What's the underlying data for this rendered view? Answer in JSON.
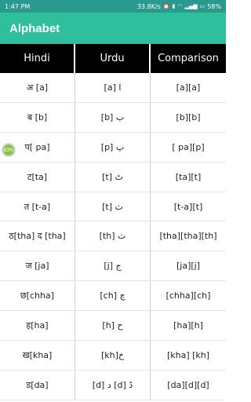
{
  "status_bar": {
    "time": "1:47 PM",
    "speed": "33.8K/s",
    "battery": "58%"
  },
  "app_bar": {
    "title": "Alphabet"
  },
  "table": {
    "headers": [
      "Hindi",
      "Urdu",
      "Comparison"
    ],
    "rows": [
      {
        "hindi": "अ [a]",
        "urdu": "[a] ا",
        "comparison": "[a][a]"
      },
      {
        "hindi": "ब [b]",
        "urdu": "[b] ب",
        "comparison": "[b][b]"
      },
      {
        "hindi": "प[ pa]",
        "urdu": "[p] پ",
        "comparison": "[ pa][p]"
      },
      {
        "hindi": "ट[ta]",
        "urdu": "[t] ٹ",
        "comparison": "[ta][t]"
      },
      {
        "hindi": "त [t-a]",
        "urdu": "[t] ث",
        "comparison": "[t-a][t]"
      },
      {
        "hindi": "ठ[tha] द [tha]",
        "urdu": "[th] ث",
        "comparison": "[tha][tha][th]"
      },
      {
        "hindi": "ज [ja]",
        "urdu": "[j] ج",
        "comparison": "[ja][j]"
      },
      {
        "hindi": "छ[chha]",
        "urdu": "[ch] چ",
        "comparison": "[chha][ch]"
      },
      {
        "hindi": "ह[ha]",
        "urdu": "[h] ح",
        "comparison": "[ha][h]"
      },
      {
        "hindi": "ख[kha]",
        "urdu": "[kh]خ",
        "comparison": "[kha] [kh]"
      },
      {
        "hindi": "ड[da]",
        "urdu": "[d] د [d] ڈ",
        "comparison": "[da][d][d]"
      }
    ]
  },
  "overlay_badge": {
    "text": "83%"
  }
}
